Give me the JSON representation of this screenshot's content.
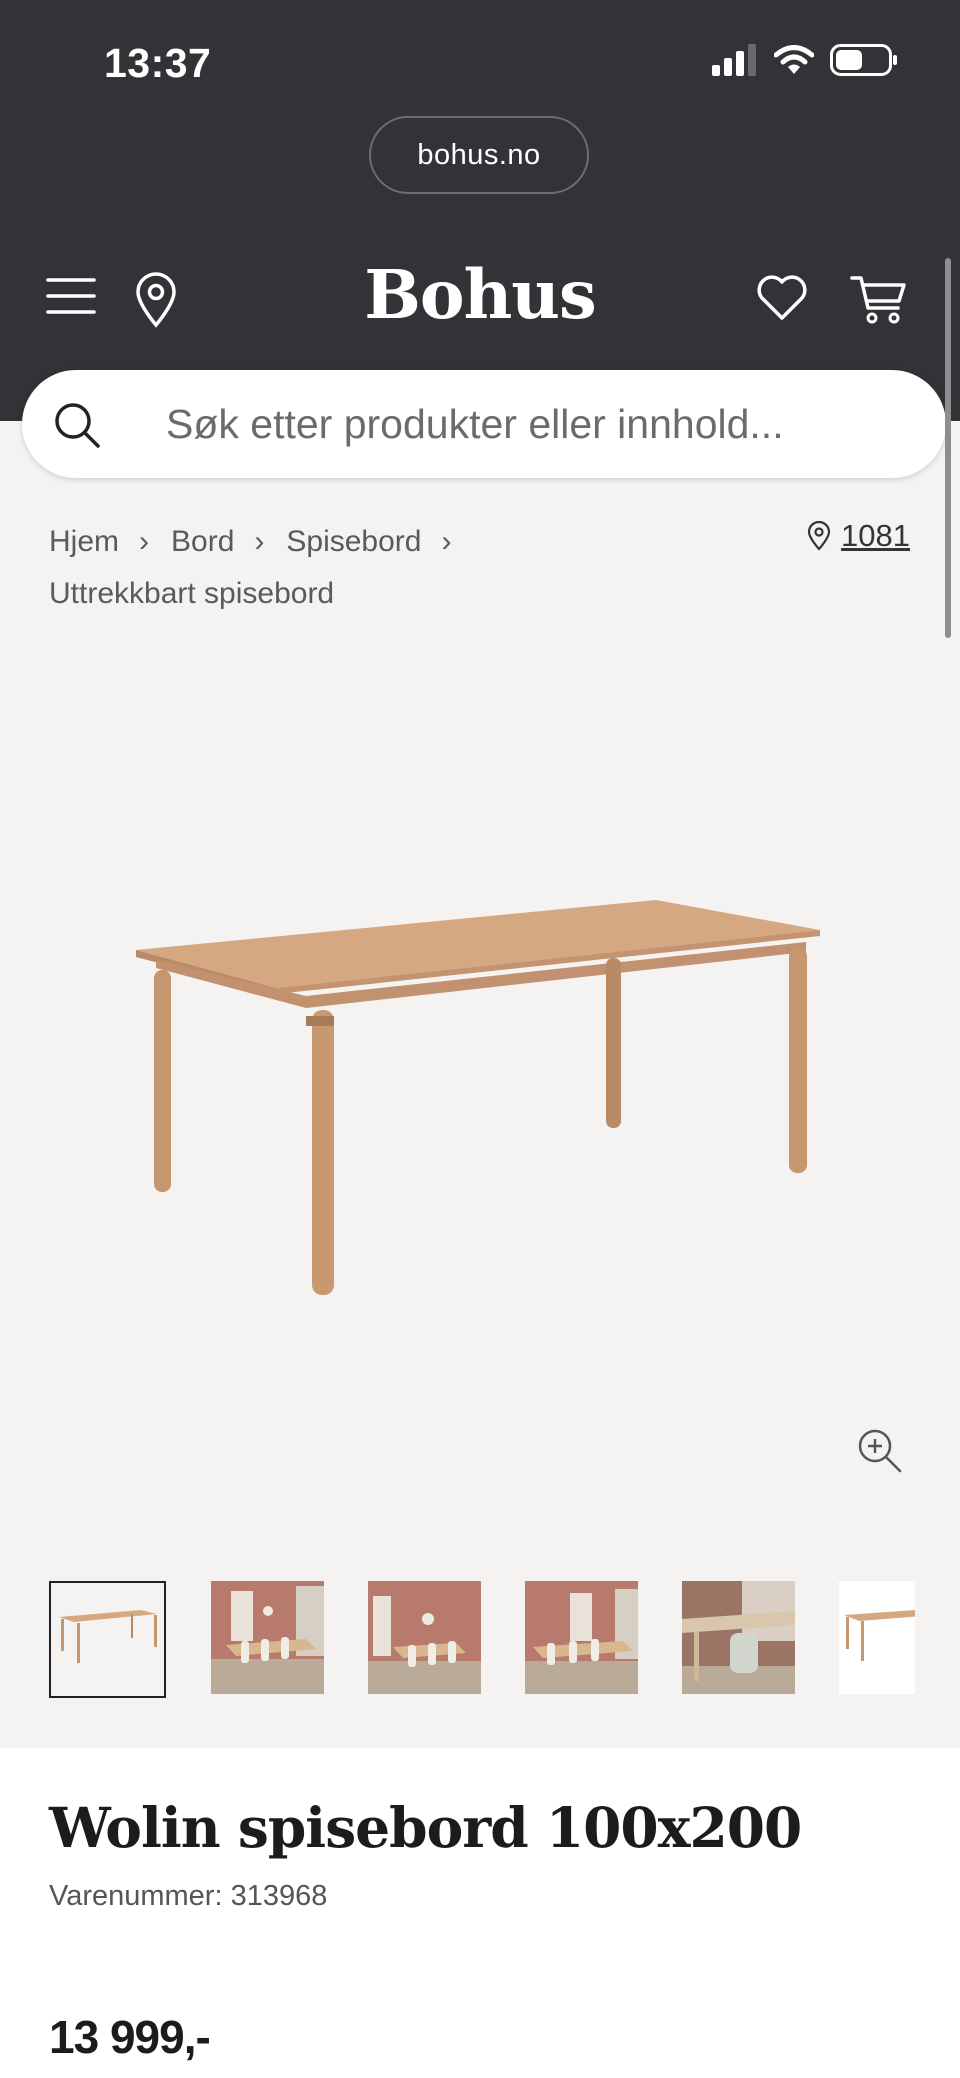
{
  "status_bar": {
    "time": "13:37"
  },
  "browser": {
    "url": "bohus.no"
  },
  "header": {
    "logo": "Bohus"
  },
  "search": {
    "placeholder": "Søk etter produkter eller innhold..."
  },
  "breadcrumb": {
    "items": [
      "Hjem",
      "Bord",
      "Spisebord",
      "Uttrekkbart spisebord"
    ]
  },
  "store": {
    "number": "1081"
  },
  "product": {
    "title": "Wolin spisebord 100x200",
    "sku": "Varenummer: 313968",
    "price": "13 999,-",
    "thumbnail_count": 6,
    "selected_thumbnail": 1
  },
  "colors": {
    "dark_header": "#333236",
    "page_bg": "#f5f3f2",
    "wood": "#d6a882",
    "wall": "#b87a6c"
  }
}
